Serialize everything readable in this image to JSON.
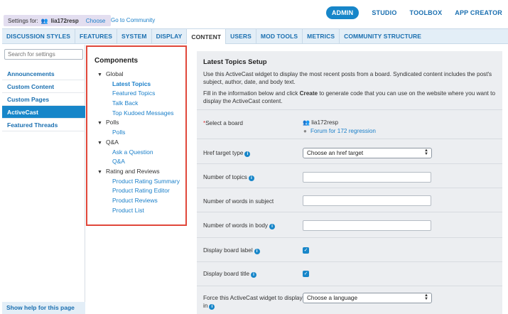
{
  "header": {
    "settings_for_label": "Settings for:",
    "settings_user": "lia172resp",
    "choose_link": "Choose",
    "goto_community": "Go to Community",
    "nav": [
      "ADMIN",
      "STUDIO",
      "TOOLBOX",
      "APP CREATOR"
    ],
    "active_nav": "ADMIN"
  },
  "tabs": [
    "DISCUSSION STYLES",
    "FEATURES",
    "SYSTEM",
    "DISPLAY",
    "CONTENT",
    "USERS",
    "MOD TOOLS",
    "METRICS",
    "COMMUNITY STRUCTURE"
  ],
  "sidebar": {
    "search_placeholder": "Search for settings",
    "items": [
      "Announcements",
      "Custom Content",
      "Custom Pages",
      "ActiveCast",
      "Featured Threads"
    ],
    "active_item": "ActiveCast",
    "help_link": "Show help for this page"
  },
  "components": {
    "title": "Components",
    "groups": [
      {
        "name": "Global",
        "items": [
          "Latest Topics",
          "Featured Topics",
          "Talk Back",
          "Top Kudoed Messages"
        ]
      },
      {
        "name": "Polls",
        "items": [
          "Polls"
        ]
      },
      {
        "name": "Q&A",
        "items": [
          "Ask a Question",
          "Q&A"
        ]
      },
      {
        "name": "Rating and Reviews",
        "items": [
          "Product Rating Summary",
          "Product Rating Editor",
          "Product Reviews",
          "Product List"
        ]
      }
    ],
    "active_item": "Latest Topics"
  },
  "setup": {
    "title": "Latest Topics Setup",
    "desc1": "Use this ActiveCast widget to display the most recent posts from a board. Syndicated content includes the post's subject, author, date, and body text.",
    "desc2_pre": "Fill in the information below and click ",
    "desc2_bold": "Create",
    "desc2_post": " to generate code that you can use on the website where you want to display the ActiveCast content.",
    "select_board_label": "Select a board",
    "board_user": "lia172resp",
    "board_link": "Forum for 172 regression",
    "href_label": "Href target type",
    "href_value": "Choose an href target",
    "num_topics_label": "Number of topics",
    "num_words_subject_label": "Number of words in subject",
    "num_words_body_label": "Number of words in body",
    "display_board_label_label": "Display board label",
    "display_board_label_checked": true,
    "display_board_title_label": "Display board title",
    "display_board_title_checked": true,
    "force_language_label_1": "Force this ActiveCast widget to display",
    "force_language_label_2": "in",
    "language_value": "Choose a language"
  }
}
